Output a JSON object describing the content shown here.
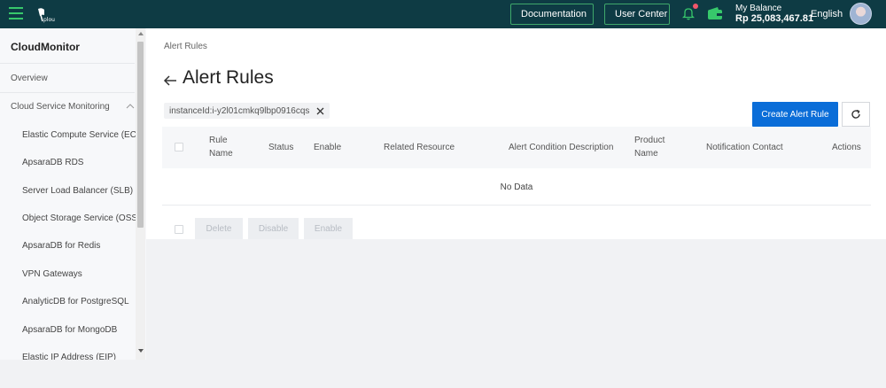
{
  "topbar": {
    "documentation_label": "Documentation",
    "user_center_label": "User Center",
    "balance_label": "My Balance",
    "balance_amount": "Rp 25,083,467.81",
    "language": "English",
    "brand_color": "#0e3b44",
    "accent_color": "#37c86b"
  },
  "sidebar": {
    "title": "CloudMonitor",
    "items": [
      {
        "label": "Overview",
        "level": "top"
      },
      {
        "label": "Cloud Service Monitoring",
        "level": "top",
        "expanded": true
      },
      {
        "label": "Elastic Compute Service (ECS)",
        "level": "sub"
      },
      {
        "label": "ApsaraDB RDS",
        "level": "sub"
      },
      {
        "label": "Server Load Balancer (SLB)",
        "level": "sub"
      },
      {
        "label": "Object Storage Service (OSS)",
        "level": "sub"
      },
      {
        "label": "ApsaraDB for Redis",
        "level": "sub"
      },
      {
        "label": "VPN Gateways",
        "level": "sub"
      },
      {
        "label": "AnalyticDB for PostgreSQL",
        "level": "sub"
      },
      {
        "label": "ApsaraDB for MongoDB",
        "level": "sub"
      },
      {
        "label": "Elastic IP Address (EIP)",
        "level": "sub"
      }
    ]
  },
  "main": {
    "breadcrumb": "Alert Rules",
    "title": "Alert Rules",
    "filter_tag": "instanceId:i-y2l01cmkq9lbp0916cqs",
    "create_button": "Create Alert Rule",
    "table": {
      "headers": {
        "rule_name_1": "Rule",
        "rule_name_2": "Name",
        "status": "Status",
        "enable": "Enable",
        "related_resource": "Related Resource",
        "alert_condition": "Alert Condition Description",
        "product_name_1": "Product",
        "product_name_2": "Name",
        "notification_contact": "Notification Contact",
        "actions": "Actions"
      },
      "empty_text": "No Data"
    },
    "bulk_actions": {
      "delete": "Delete",
      "disable": "Disable",
      "enable": "Enable"
    },
    "primary_color": "#0a6dd8"
  }
}
